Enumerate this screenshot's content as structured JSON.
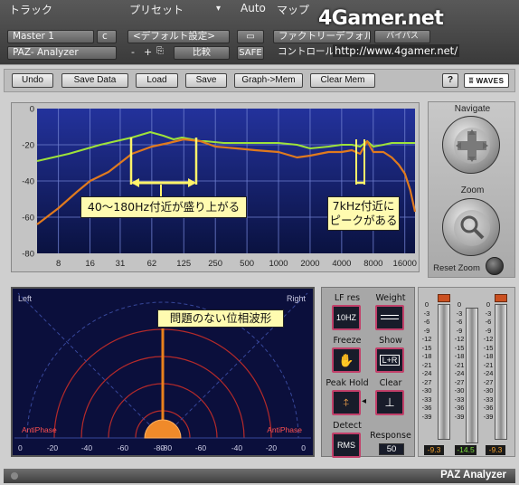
{
  "host": {
    "track_label": "トラック",
    "preset_label": "プリセット",
    "auto_label": "Auto",
    "map_label": "マップ",
    "track_name": "Master 1",
    "track_c": "c",
    "plugin_name": "PAZ- Analyzer",
    "preset_value": "<デフォルト設定>",
    "minus": "-",
    "plus": "+",
    "compare": "比較",
    "safe": "SAFE",
    "factory": "ファクトリーデフォルト",
    "bypass": "バイパス",
    "controls": "コントロール",
    "watermark": "4Gamer.net",
    "watermark_url": "http://www.4gamer.net/"
  },
  "toolbar": {
    "undo": "Undo",
    "save_data": "Save Data",
    "load": "Load",
    "save": "Save",
    "graph_mem": "Graph->Mem",
    "clear_mem": "Clear Mem",
    "help": "?",
    "brand": "WAVES"
  },
  "navigate": {
    "navigate_label": "Navigate",
    "zoom_label": "Zoom",
    "reset_zoom": "Reset Zoom"
  },
  "chart_data": {
    "type": "line",
    "xlabel": "",
    "ylabel": "",
    "y_ticks": [
      0,
      -20,
      -40,
      -60,
      -80
    ],
    "ylim": [
      -80,
      0
    ],
    "x_ticks": [
      "8",
      "16",
      "31",
      "62",
      "125",
      "250",
      "500",
      "1000",
      "2000",
      "4000",
      "8000",
      "16000"
    ],
    "xlim_hz": [
      5,
      20000
    ],
    "x_scale": "log",
    "grid": true,
    "series": [
      {
        "color": "#9ee23a",
        "x_hz": [
          5,
          10,
          20,
          40,
          60,
          80,
          100,
          120,
          150,
          180,
          200,
          300,
          500,
          800,
          1000,
          1500,
          2000,
          3000,
          4000,
          5000,
          6000,
          7000,
          8000,
          10000,
          12000,
          16000,
          20000
        ],
        "y_db": [
          -29,
          -25,
          -20,
          -16,
          -13,
          -15,
          -17,
          -16,
          -17,
          -18,
          -18,
          -19,
          -19,
          -19,
          -19,
          -20,
          -22,
          -21,
          -20,
          -20,
          -21,
          -18,
          -21,
          -20,
          -19,
          -19,
          -19
        ]
      },
      {
        "color": "#e07a1e",
        "x_hz": [
          5,
          8,
          12,
          16,
          24,
          31,
          40,
          62,
          90,
          125,
          180,
          250,
          400,
          600,
          1000,
          1500,
          2000,
          3000,
          4000,
          5000,
          6000,
          7000,
          8000,
          10000,
          12000,
          14000,
          16000,
          18000,
          20000
        ],
        "y_db": [
          -64,
          -55,
          -46,
          -40,
          -35,
          -30,
          -25,
          -21,
          -19,
          -17,
          -18,
          -21,
          -22,
          -23,
          -24,
          -27,
          -26,
          -24,
          -24,
          -23,
          -25,
          -18,
          -24,
          -24,
          -27,
          -31,
          -36,
          -45,
          -57
        ]
      }
    ]
  },
  "annotations": {
    "bass_bump": "40～180Hz付近が盛り上がる",
    "peak_7k_line1": "7kHz付近に",
    "peak_7k_line2": "ピークがある",
    "phase_ok": "問題のない位相波形"
  },
  "phase": {
    "left": "Left",
    "right": "Right",
    "anti_left": "AntiPhase",
    "anti_right": "AntiPhase",
    "ticks": [
      "0",
      "-20",
      "-40",
      "-60",
      "-80",
      "-80",
      "-60",
      "-40",
      "-20",
      "0"
    ]
  },
  "controls": {
    "lf_res": "LF res",
    "lf_res_btn": "10HZ",
    "weight": "Weight",
    "freeze": "Freeze",
    "show": "Show",
    "show_btn": "L+R",
    "peak_hold": "Peak Hold",
    "clear": "Clear",
    "detect": "Detect",
    "detect_btn": "RMS",
    "response": "Response",
    "response_value": "50"
  },
  "meters": {
    "scale": [
      "0",
      "-3",
      "-6",
      "-9",
      "-12",
      "-15",
      "-18",
      "-21",
      "-24",
      "-27",
      "-30",
      "-33",
      "-36",
      "-39"
    ],
    "left_reading": "-9.3",
    "center_reading": "-14.5",
    "right_reading": "-9.3",
    "reading_colors": {
      "left": "#f2a030",
      "center": "#7de040",
      "right": "#f2a030"
    }
  },
  "footer": {
    "title": "PAZ Analyzer"
  }
}
